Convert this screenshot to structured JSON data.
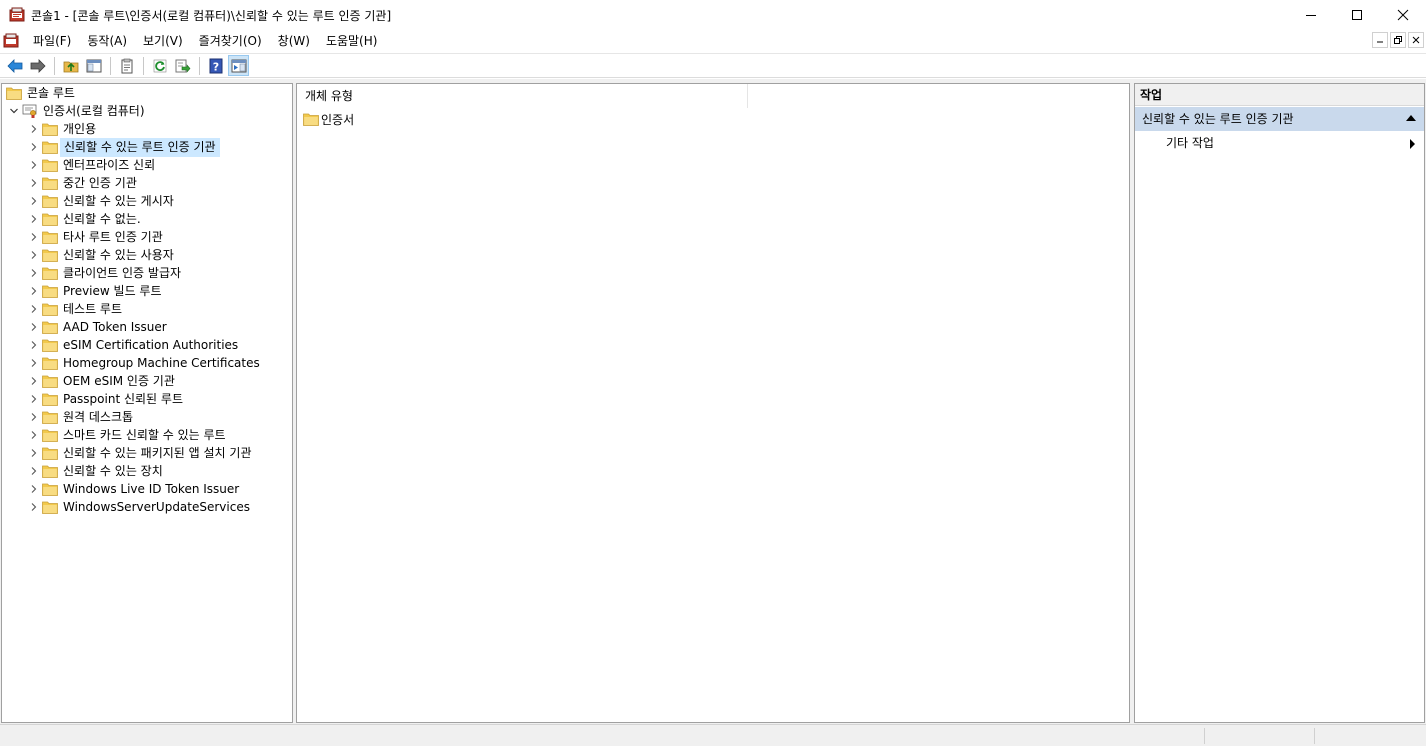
{
  "window": {
    "title": "콘솔1 - [콘솔 루트\\인증서(로컬 컴퓨터)\\신뢰할 수 있는 루트 인증 기관]"
  },
  "menu": {
    "items": [
      "파일(F)",
      "동작(A)",
      "보기(V)",
      "즐겨찾기(O)",
      "창(W)",
      "도움말(H)"
    ]
  },
  "toolbar": {
    "buttons": [
      "back-arrow-icon",
      "forward-arrow-icon",
      "up-folder-icon",
      "show-hide-tree-icon",
      "properties-icon",
      "refresh-icon",
      "export-list-icon",
      "help-icon",
      "show-hide-action-pane-icon"
    ]
  },
  "tree": {
    "root": "콘솔 루트",
    "computer": "인증서(로컬 컴퓨터)",
    "selected_index": 1,
    "items": [
      "개인용",
      "신뢰할 수 있는 루트 인증 기관",
      "엔터프라이즈 신뢰",
      "중간 인증 기관",
      "신뢰할 수 있는 게시자",
      "신뢰할 수 없는.",
      "타사 루트 인증 기관",
      "신뢰할 수 있는 사용자",
      "클라이언트 인증 발급자",
      "Preview 빌드 루트",
      "테스트 루트",
      "AAD Token Issuer",
      "eSIM Certification Authorities",
      "Homegroup Machine Certificates",
      "OEM eSIM 인증 기관",
      "Passpoint 신뢰된 루트",
      "원격 데스크톱",
      "스마트 카드 신뢰할 수 있는 루트",
      "신뢰할 수 있는 패키지된 앱 설치 기관",
      "신뢰할 수 있는 장치",
      "Windows Live ID Token Issuer",
      "WindowsServerUpdateServices"
    ]
  },
  "list": {
    "column_header": "개체 유형",
    "rows": [
      "인증서"
    ]
  },
  "actions": {
    "header": "작업",
    "section_title": "신뢰할 수 있는 루트 인증 기관",
    "items": [
      "기타 작업"
    ]
  },
  "colors": {
    "selection": "#cce8ff",
    "action_section": "#c9d9ec",
    "folder": "#f2c94c"
  }
}
